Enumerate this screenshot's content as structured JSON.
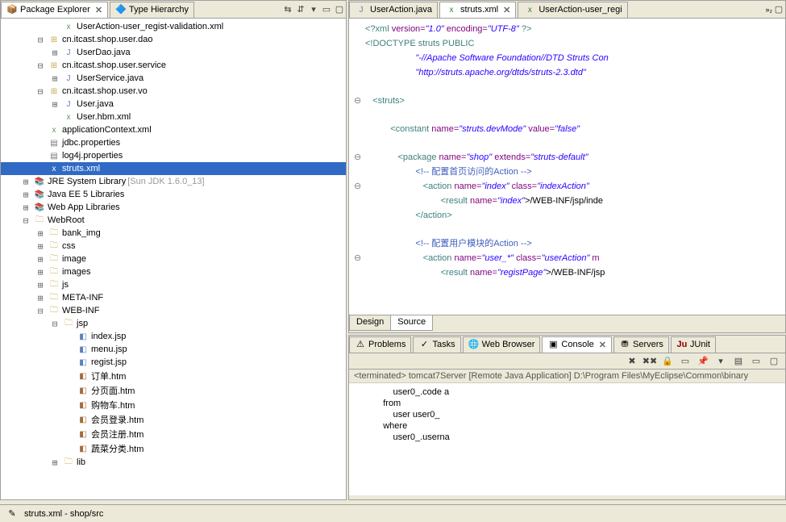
{
  "left": {
    "tabs": {
      "pkg": "Package Explorer",
      "type": "Type Hierarchy"
    },
    "tree": [
      {
        "d": 3,
        "t": "",
        "i": "xml",
        "l": "UserAction-user_regist-validation.xml"
      },
      {
        "d": 2,
        "t": "-",
        "i": "pkg",
        "l": "cn.itcast.shop.user.dao"
      },
      {
        "d": 3,
        "t": "+",
        "i": "java",
        "l": "UserDao.java"
      },
      {
        "d": 2,
        "t": "-",
        "i": "pkg",
        "l": "cn.itcast.shop.user.service"
      },
      {
        "d": 3,
        "t": "+",
        "i": "java",
        "l": "UserService.java"
      },
      {
        "d": 2,
        "t": "-",
        "i": "pkg",
        "l": "cn.itcast.shop.user.vo"
      },
      {
        "d": 3,
        "t": "+",
        "i": "java",
        "l": "User.java"
      },
      {
        "d": 3,
        "t": "",
        "i": "xml",
        "l": "User.hbm.xml"
      },
      {
        "d": 2,
        "t": "",
        "i": "xml",
        "l": "applicationContext.xml"
      },
      {
        "d": 2,
        "t": "",
        "i": "file",
        "l": "jdbc.properties"
      },
      {
        "d": 2,
        "t": "",
        "i": "file",
        "l": "log4j.properties"
      },
      {
        "d": 2,
        "t": "",
        "i": "xml",
        "l": "struts.xml",
        "sel": true
      },
      {
        "d": 1,
        "t": "+",
        "i": "lib",
        "l": "JRE System Library",
        "deco": "[Sun JDK 1.6.0_13]"
      },
      {
        "d": 1,
        "t": "+",
        "i": "lib",
        "l": "Java EE 5 Libraries"
      },
      {
        "d": 1,
        "t": "+",
        "i": "lib",
        "l": "Web App Libraries"
      },
      {
        "d": 1,
        "t": "-",
        "i": "folder",
        "l": "WebRoot"
      },
      {
        "d": 2,
        "t": "+",
        "i": "folder",
        "l": "bank_img"
      },
      {
        "d": 2,
        "t": "+",
        "i": "folder",
        "l": "css"
      },
      {
        "d": 2,
        "t": "+",
        "i": "folder",
        "l": "image"
      },
      {
        "d": 2,
        "t": "+",
        "i": "folder",
        "l": "images"
      },
      {
        "d": 2,
        "t": "+",
        "i": "folder",
        "l": "js"
      },
      {
        "d": 2,
        "t": "+",
        "i": "folder",
        "l": "META-INF"
      },
      {
        "d": 2,
        "t": "-",
        "i": "folder",
        "l": "WEB-INF"
      },
      {
        "d": 3,
        "t": "-",
        "i": "folder",
        "l": "jsp"
      },
      {
        "d": 4,
        "t": "",
        "i": "jsp",
        "l": "index.jsp"
      },
      {
        "d": 4,
        "t": "",
        "i": "jsp",
        "l": "menu.jsp"
      },
      {
        "d": 4,
        "t": "",
        "i": "jsp",
        "l": "regist.jsp"
      },
      {
        "d": 4,
        "t": "",
        "i": "htm",
        "l": "订单.htm"
      },
      {
        "d": 4,
        "t": "",
        "i": "htm",
        "l": "分页面.htm"
      },
      {
        "d": 4,
        "t": "",
        "i": "htm",
        "l": "购物车.htm"
      },
      {
        "d": 4,
        "t": "",
        "i": "htm",
        "l": "会员登录.htm"
      },
      {
        "d": 4,
        "t": "",
        "i": "htm",
        "l": "会员注册.htm"
      },
      {
        "d": 4,
        "t": "",
        "i": "htm",
        "l": "蔬菜分类.htm"
      },
      {
        "d": 3,
        "t": "+",
        "i": "folder",
        "l": "lib"
      }
    ]
  },
  "editor_tabs": {
    "t1": "UserAction.java",
    "t2": "struts.xml",
    "t3": "UserAction-user_regi"
  },
  "xml": {
    "decl_open": "<?xml ",
    "ver_n": "version=",
    "ver_v": "\"1.0\"",
    "enc_n": " encoding=",
    "enc_v": "\"UTF-8\"",
    "decl_close": " ?>",
    "doctype": "<!DOCTYPE struts PUBLIC",
    "dtd1": "\"-//Apache Software Foundation//DTD Struts Con",
    "dtd2": "\"http://struts.apache.org/dtds/struts-2.3.dtd\"",
    "struts_o": "<struts>",
    "const_o": "<constant ",
    "const_n": "name=",
    "const_nv": "\"struts.devMode\"",
    "const_v": " value=",
    "const_vv": "\"false\"",
    "pkg_o": "<package ",
    "pkg_n": "name=",
    "pkg_nv": "\"shop\"",
    "pkg_e": " extends=",
    "pkg_ev": "\"struts-default\"",
    "c1": "<!-- 配置首页访问的Action -->",
    "act1_o": "<action ",
    "act1_n": "name=",
    "act1_nv": "\"index\"",
    "act1_c": " class=",
    "act1_cv": "\"indexAction\"",
    "res1_o": "<result ",
    "res1_n": "name=",
    "res1_nv": "\"index\"",
    "res1_t": ">/WEB-INF/jsp/inde",
    "act1_close": "</action>",
    "c2": "<!-- 配置用户模块的Action -->",
    "act2_o": "<action ",
    "act2_n": "name=",
    "act2_nv": "\"user_*\"",
    "act2_c": " class=",
    "act2_cv": "\"userAction\"",
    "act2_m": " m",
    "res2_o": "<result ",
    "res2_n": "name=",
    "res2_nv": "\"registPage\"",
    "res2_t": ">/WEB-INF/jsp"
  },
  "bottom_tabs": {
    "design": "Design",
    "source": "Source"
  },
  "console": {
    "tabs": {
      "problems": "Problems",
      "tasks": "Tasks",
      "web": "Web Browser",
      "console": "Console",
      "servers": "Servers",
      "junit": "JUnit"
    },
    "head": "<terminated> tomcat7Server [Remote Java Application] D:\\Program Files\\MyEclipse\\Common\\binary",
    "l1": "        user0_.code a",
    "l2": "    from",
    "l3": "        user user0_ ",
    "l4": "    where",
    "l5": "        user0_.userna"
  },
  "status": "struts.xml - shop/src"
}
